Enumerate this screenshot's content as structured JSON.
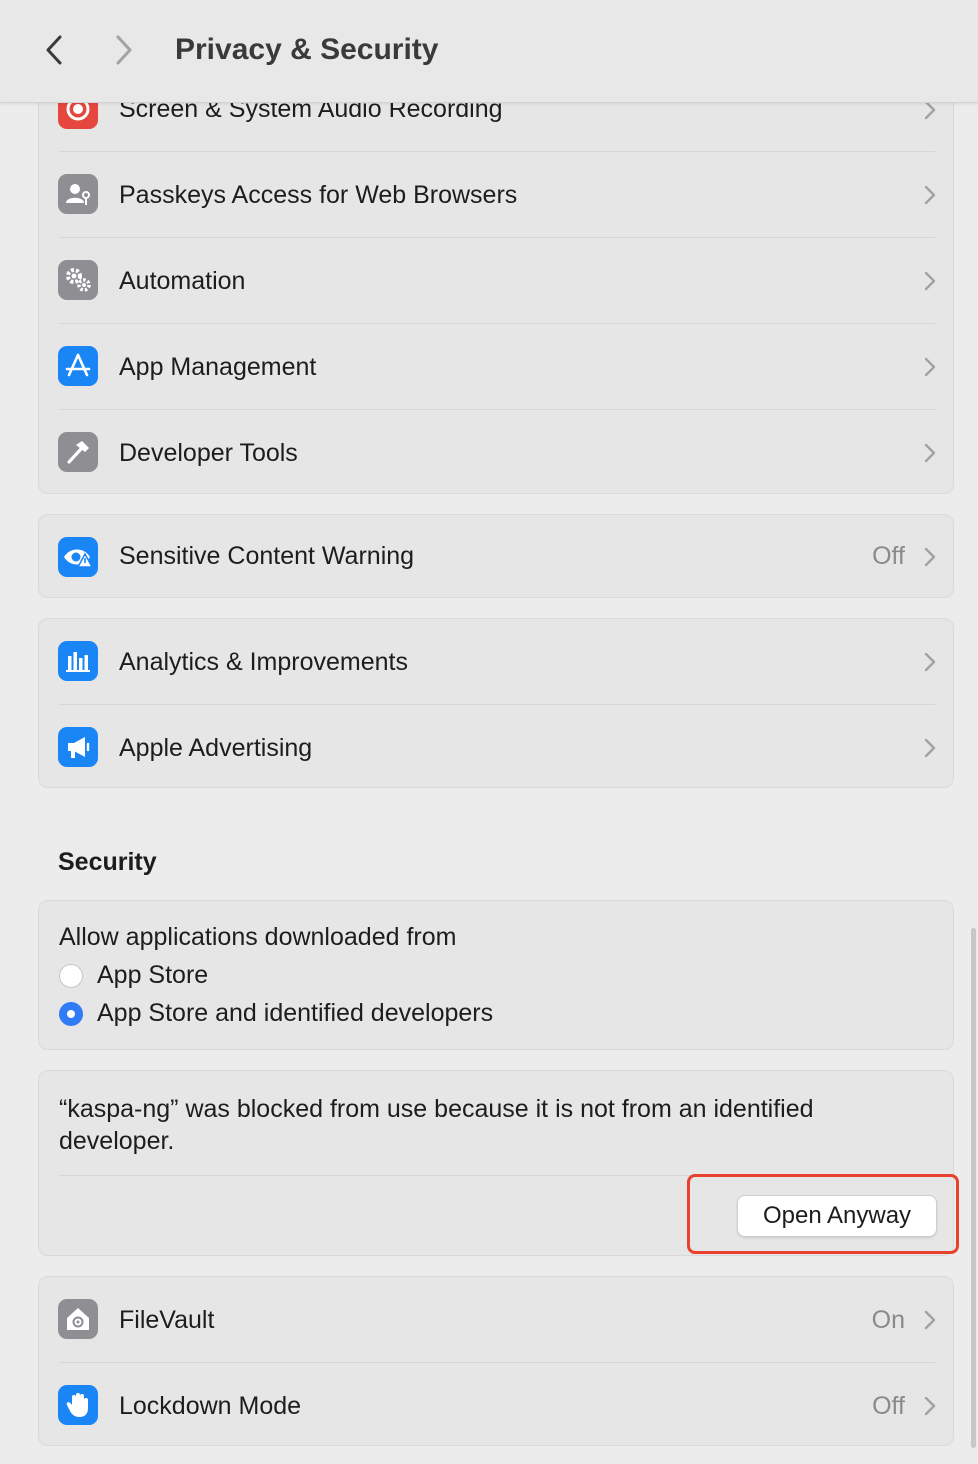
{
  "titlebar": {
    "title": "Privacy & Security",
    "back_icon": "chevron-left-icon",
    "forward_icon": "chevron-right-icon"
  },
  "privacy_group_1": {
    "items": [
      {
        "label": "Screen & System Audio Recording",
        "icon": "record-icon",
        "icon_color": "#e5463d"
      },
      {
        "label": "Passkeys Access for Web Browsers",
        "icon": "person-key-icon",
        "icon_color": "#8e8e93"
      },
      {
        "label": "Automation",
        "icon": "gears-icon",
        "icon_color": "#8e8e93"
      },
      {
        "label": "App Management",
        "icon": "app-store-icon",
        "icon_color": "#1a86f5"
      },
      {
        "label": "Developer Tools",
        "icon": "hammer-icon",
        "icon_color": "#8e8e93"
      }
    ]
  },
  "privacy_group_2": {
    "items": [
      {
        "label": "Sensitive Content Warning",
        "value": "Off",
        "icon": "eye-warning-icon",
        "icon_color": "#1a86f5"
      }
    ]
  },
  "privacy_group_3": {
    "items": [
      {
        "label": "Analytics & Improvements",
        "icon": "bar-chart-icon",
        "icon_color": "#1a86f5"
      },
      {
        "label": "Apple Advertising",
        "icon": "megaphone-icon",
        "icon_color": "#1a86f5"
      }
    ]
  },
  "security": {
    "title": "Security",
    "allow_label": "Allow applications downloaded from",
    "options": [
      {
        "label": "App Store",
        "selected": false
      },
      {
        "label": "App Store and identified developers",
        "selected": true
      }
    ],
    "blocked_message": "“kaspa-ng” was blocked from use because it is not from an identified developer.",
    "open_anyway_label": "Open Anyway"
  },
  "security_group": {
    "items": [
      {
        "label": "FileVault",
        "value": "On",
        "icon": "house-lock-icon",
        "icon_color": "#8e8e93"
      },
      {
        "label": "Lockdown Mode",
        "value": "Off",
        "icon": "hand-icon",
        "icon_color": "#1a86f5"
      }
    ]
  },
  "colors": {
    "accent": "#2f7cf6",
    "highlight": "#e8412f"
  }
}
